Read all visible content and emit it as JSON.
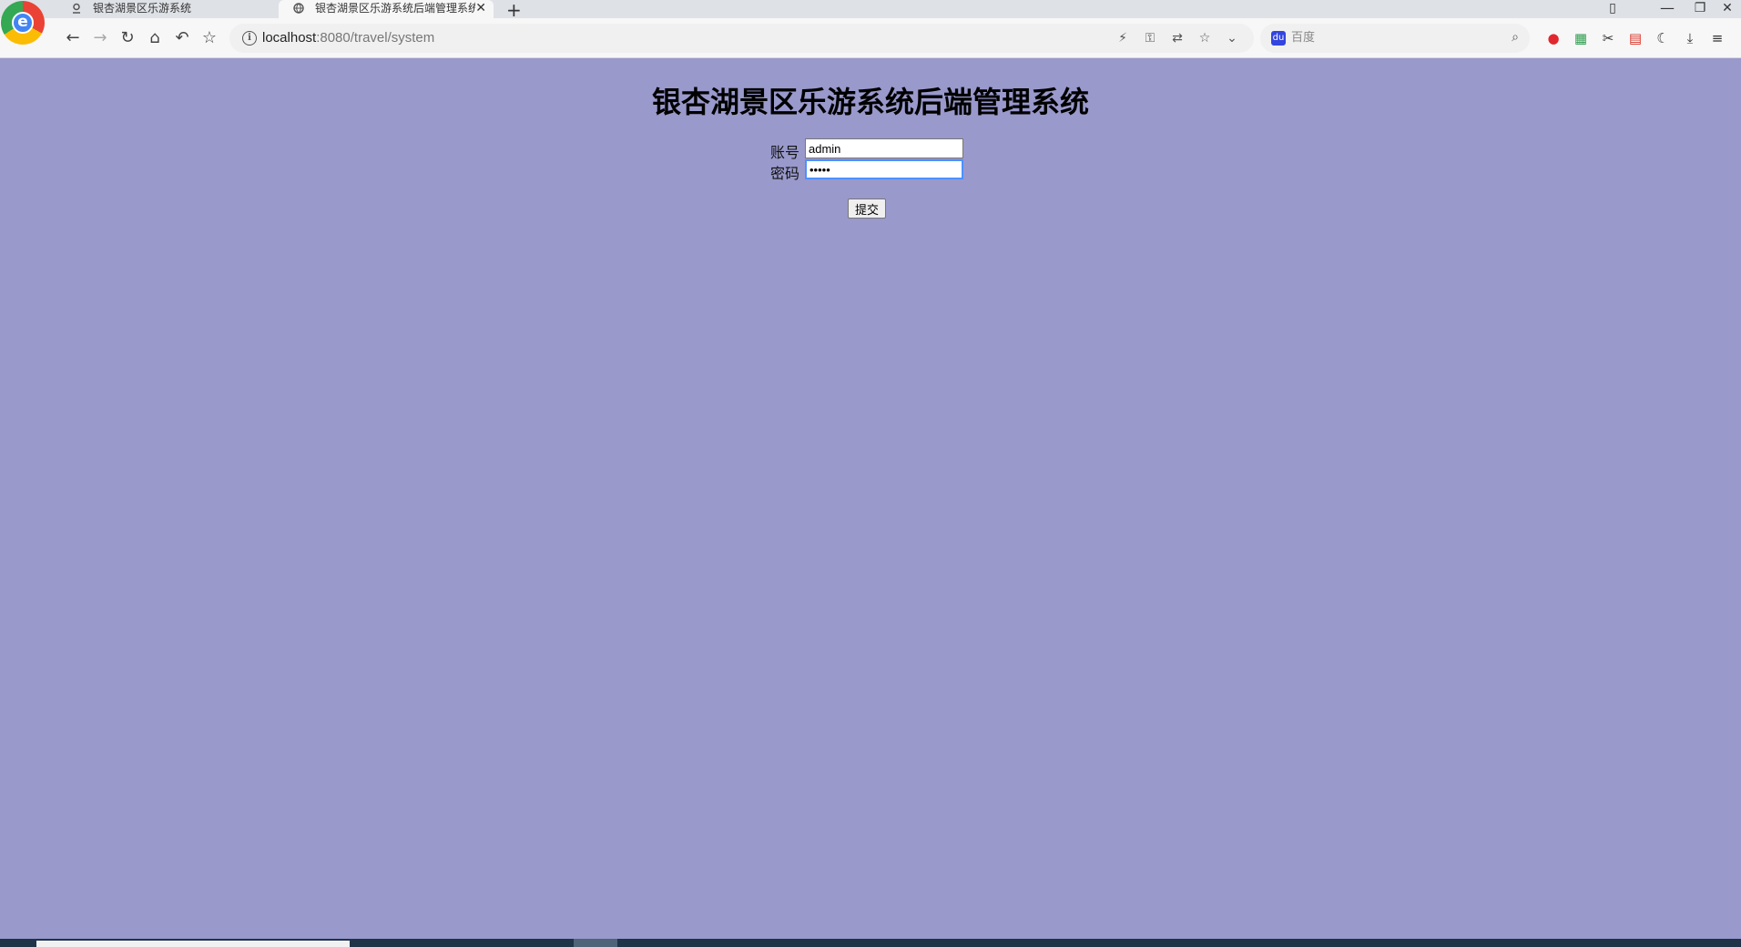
{
  "browser": {
    "tabs": [
      {
        "title": "银杏湖景区乐游系统"
      },
      {
        "title": "银杏湖景区乐游系统后端管理系统"
      }
    ],
    "address": {
      "host": "localhost",
      "rest": ":8080/travel/system"
    },
    "search": {
      "placeholder": "百度",
      "engine_glyph": "du"
    },
    "accent": "#4285f4"
  },
  "page": {
    "title": "银杏湖景区乐游系统后端管理系统",
    "background": "#9999cc",
    "form": {
      "account_label": "账号",
      "account_value": "admin",
      "password_label": "密码",
      "password_value": "•••••",
      "submit_label": "提交"
    }
  }
}
